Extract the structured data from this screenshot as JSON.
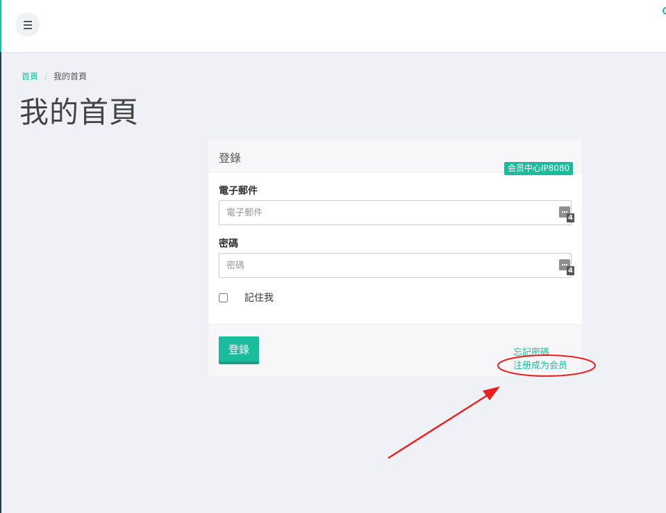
{
  "header": {
    "menu_icon": "hamburger-menu-icon"
  },
  "breadcrumb": {
    "home": "首頁",
    "separator": "/",
    "current": "我的首頁"
  },
  "page_title": "我的首頁",
  "login_card": {
    "title": "登錄",
    "badge": "会员中心IP8080",
    "email": {
      "label": "電子郵件",
      "placeholder": "電子郵件",
      "value": "",
      "password_manager_count": "4"
    },
    "password": {
      "label": "密碼",
      "placeholder": "密碼",
      "value": "",
      "password_manager_count": "4"
    },
    "remember_label": "記住我",
    "remember_checked": false,
    "login_button": "登錄",
    "forgot_password": "忘記密碼",
    "register": "注册成为会员"
  },
  "colors": {
    "accent": "#1abc9c",
    "annotation": "#e8201f",
    "background": "#f0f1f6"
  }
}
